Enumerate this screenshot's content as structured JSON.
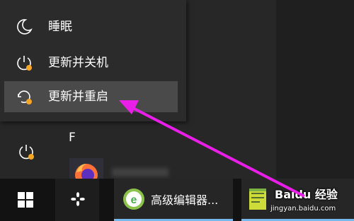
{
  "power_menu": {
    "items": [
      {
        "label": "睡眠",
        "icon": "moon-icon"
      },
      {
        "label": "更新并关机",
        "icon": "power-update-icon"
      },
      {
        "label": "更新并重启",
        "icon": "restart-update-icon"
      }
    ]
  },
  "start_menu": {
    "section_letter": "F"
  },
  "taskbar": {
    "apps": [
      {
        "icon": "fan-icon"
      },
      {
        "label": "高级编辑器...",
        "icon": "editor-e-icon"
      },
      {
        "label": "Baidu 经验",
        "icon": "notepad-icon"
      }
    ]
  },
  "watermark": {
    "brand": "Baidu 经验",
    "url": "jingyan.baidu.com"
  },
  "colors": {
    "accent_orange": "#f5a623",
    "annotation_magenta": "#e91ee9",
    "highlight": "#4a4a4a"
  }
}
